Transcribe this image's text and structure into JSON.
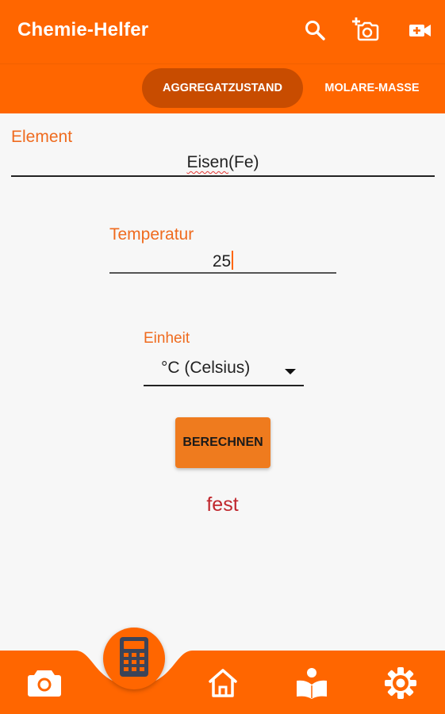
{
  "app": {
    "title": "Chemie-Helfer"
  },
  "toolbar_icons": [
    "search-icon",
    "camera-add-icon",
    "video-add-icon"
  ],
  "tabs": [
    {
      "label": "AGGREGATZUSTAND",
      "active": true
    },
    {
      "label": "MOLARE-MASSE",
      "active": false
    }
  ],
  "form": {
    "element": {
      "label": "Element",
      "value_word": "Eisen",
      "value_rest": "(Fe)"
    },
    "temperature": {
      "label": "Temperatur",
      "value": "25"
    },
    "unit": {
      "label": "Einheit",
      "selected": "°C (Celsius)"
    }
  },
  "calculate_button": {
    "label": "BERECHNEN"
  },
  "result": {
    "text": "fest"
  },
  "bottom_nav": {
    "items": [
      "camera-icon",
      "calculator-icon",
      "home-icon",
      "reading-book-icon",
      "settings-gear-icon"
    ],
    "active": "calculator-icon"
  },
  "colors": {
    "primary": "#ff6600",
    "tab_active": "#c84c00",
    "label": "#ef6b1f",
    "button": "#ef7b1e",
    "result": "#c0272d",
    "icon_dark": "#3c4458"
  }
}
